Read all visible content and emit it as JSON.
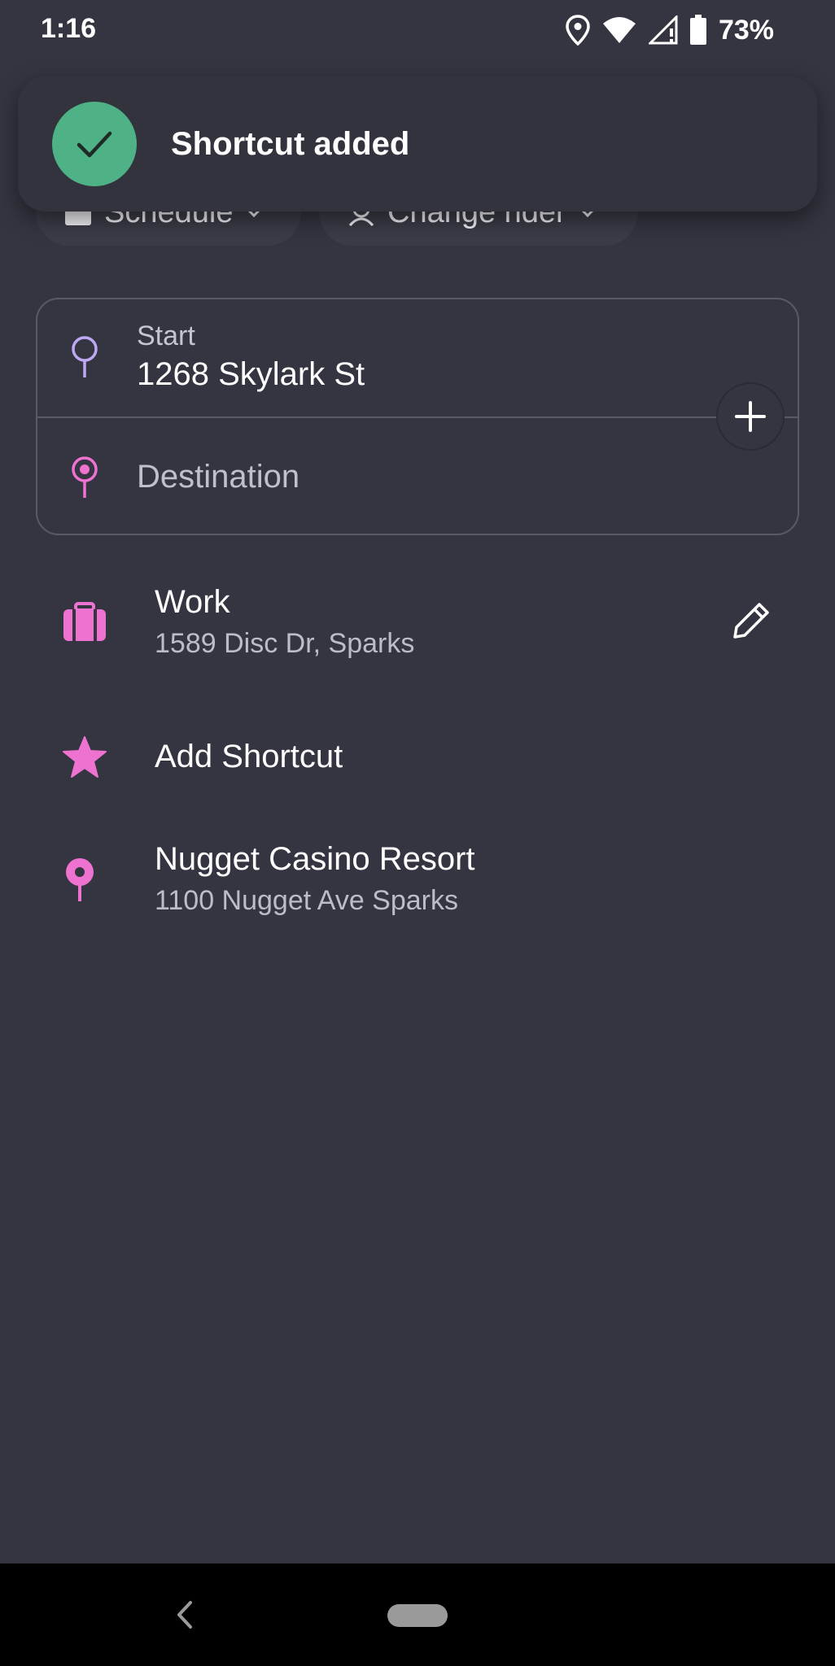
{
  "status_bar": {
    "time": "1:16",
    "battery_percent": "73%",
    "icons": [
      "location-icon",
      "wifi-icon",
      "signal-icon",
      "battery-icon"
    ]
  },
  "toast": {
    "message": "Shortcut added",
    "icon": "check-icon",
    "color": "#4fb286"
  },
  "chips": {
    "schedule_label": "Schedule",
    "change_rider_label": "Change rider"
  },
  "route": {
    "start_label": "Start",
    "start_value": "1268 Skylark St",
    "destination_placeholder": "Destination"
  },
  "list": {
    "work": {
      "title": "Work",
      "subtitle": "1589 Disc Dr, Sparks",
      "icon": "briefcase-icon"
    },
    "add_shortcut": {
      "title": "Add Shortcut",
      "icon": "star-icon"
    },
    "recent": {
      "title": "Nugget Casino Resort",
      "subtitle": "1100 Nugget Ave Sparks",
      "icon": "pin-icon"
    }
  },
  "colors": {
    "background": "#353541",
    "accent_pink": "#ee72cf",
    "start_purple": "#bfa8f2",
    "success_green": "#4fb286"
  }
}
